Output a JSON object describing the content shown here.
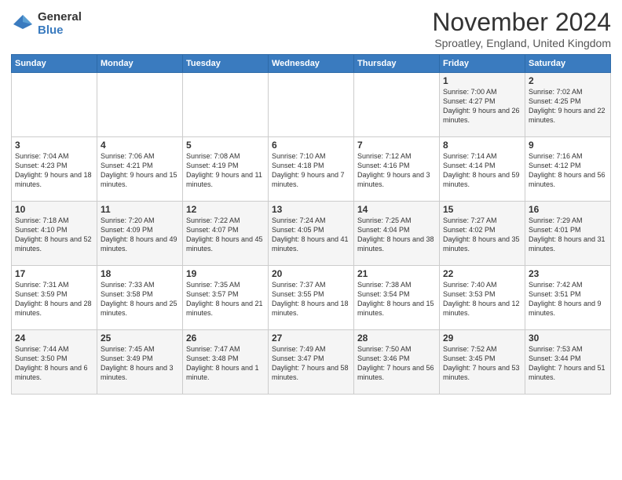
{
  "logo": {
    "general": "General",
    "blue": "Blue"
  },
  "header": {
    "month_title": "November 2024",
    "location": "Sproatley, England, United Kingdom"
  },
  "weekdays": [
    "Sunday",
    "Monday",
    "Tuesday",
    "Wednesday",
    "Thursday",
    "Friday",
    "Saturday"
  ],
  "weeks": [
    [
      {
        "day": "",
        "info": ""
      },
      {
        "day": "",
        "info": ""
      },
      {
        "day": "",
        "info": ""
      },
      {
        "day": "",
        "info": ""
      },
      {
        "day": "",
        "info": ""
      },
      {
        "day": "1",
        "info": "Sunrise: 7:00 AM\nSunset: 4:27 PM\nDaylight: 9 hours and 26 minutes."
      },
      {
        "day": "2",
        "info": "Sunrise: 7:02 AM\nSunset: 4:25 PM\nDaylight: 9 hours and 22 minutes."
      }
    ],
    [
      {
        "day": "3",
        "info": "Sunrise: 7:04 AM\nSunset: 4:23 PM\nDaylight: 9 hours and 18 minutes."
      },
      {
        "day": "4",
        "info": "Sunrise: 7:06 AM\nSunset: 4:21 PM\nDaylight: 9 hours and 15 minutes."
      },
      {
        "day": "5",
        "info": "Sunrise: 7:08 AM\nSunset: 4:19 PM\nDaylight: 9 hours and 11 minutes."
      },
      {
        "day": "6",
        "info": "Sunrise: 7:10 AM\nSunset: 4:18 PM\nDaylight: 9 hours and 7 minutes."
      },
      {
        "day": "7",
        "info": "Sunrise: 7:12 AM\nSunset: 4:16 PM\nDaylight: 9 hours and 3 minutes."
      },
      {
        "day": "8",
        "info": "Sunrise: 7:14 AM\nSunset: 4:14 PM\nDaylight: 8 hours and 59 minutes."
      },
      {
        "day": "9",
        "info": "Sunrise: 7:16 AM\nSunset: 4:12 PM\nDaylight: 8 hours and 56 minutes."
      }
    ],
    [
      {
        "day": "10",
        "info": "Sunrise: 7:18 AM\nSunset: 4:10 PM\nDaylight: 8 hours and 52 minutes."
      },
      {
        "day": "11",
        "info": "Sunrise: 7:20 AM\nSunset: 4:09 PM\nDaylight: 8 hours and 49 minutes."
      },
      {
        "day": "12",
        "info": "Sunrise: 7:22 AM\nSunset: 4:07 PM\nDaylight: 8 hours and 45 minutes."
      },
      {
        "day": "13",
        "info": "Sunrise: 7:24 AM\nSunset: 4:05 PM\nDaylight: 8 hours and 41 minutes."
      },
      {
        "day": "14",
        "info": "Sunrise: 7:25 AM\nSunset: 4:04 PM\nDaylight: 8 hours and 38 minutes."
      },
      {
        "day": "15",
        "info": "Sunrise: 7:27 AM\nSunset: 4:02 PM\nDaylight: 8 hours and 35 minutes."
      },
      {
        "day": "16",
        "info": "Sunrise: 7:29 AM\nSunset: 4:01 PM\nDaylight: 8 hours and 31 minutes."
      }
    ],
    [
      {
        "day": "17",
        "info": "Sunrise: 7:31 AM\nSunset: 3:59 PM\nDaylight: 8 hours and 28 minutes."
      },
      {
        "day": "18",
        "info": "Sunrise: 7:33 AM\nSunset: 3:58 PM\nDaylight: 8 hours and 25 minutes."
      },
      {
        "day": "19",
        "info": "Sunrise: 7:35 AM\nSunset: 3:57 PM\nDaylight: 8 hours and 21 minutes."
      },
      {
        "day": "20",
        "info": "Sunrise: 7:37 AM\nSunset: 3:55 PM\nDaylight: 8 hours and 18 minutes."
      },
      {
        "day": "21",
        "info": "Sunrise: 7:38 AM\nSunset: 3:54 PM\nDaylight: 8 hours and 15 minutes."
      },
      {
        "day": "22",
        "info": "Sunrise: 7:40 AM\nSunset: 3:53 PM\nDaylight: 8 hours and 12 minutes."
      },
      {
        "day": "23",
        "info": "Sunrise: 7:42 AM\nSunset: 3:51 PM\nDaylight: 8 hours and 9 minutes."
      }
    ],
    [
      {
        "day": "24",
        "info": "Sunrise: 7:44 AM\nSunset: 3:50 PM\nDaylight: 8 hours and 6 minutes."
      },
      {
        "day": "25",
        "info": "Sunrise: 7:45 AM\nSunset: 3:49 PM\nDaylight: 8 hours and 3 minutes."
      },
      {
        "day": "26",
        "info": "Sunrise: 7:47 AM\nSunset: 3:48 PM\nDaylight: 8 hours and 1 minute."
      },
      {
        "day": "27",
        "info": "Sunrise: 7:49 AM\nSunset: 3:47 PM\nDaylight: 7 hours and 58 minutes."
      },
      {
        "day": "28",
        "info": "Sunrise: 7:50 AM\nSunset: 3:46 PM\nDaylight: 7 hours and 56 minutes."
      },
      {
        "day": "29",
        "info": "Sunrise: 7:52 AM\nSunset: 3:45 PM\nDaylight: 7 hours and 53 minutes."
      },
      {
        "day": "30",
        "info": "Sunrise: 7:53 AM\nSunset: 3:44 PM\nDaylight: 7 hours and 51 minutes."
      }
    ]
  ]
}
